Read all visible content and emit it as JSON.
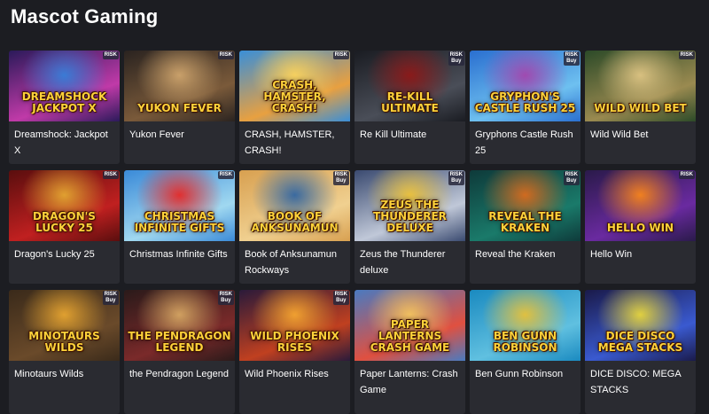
{
  "header": {
    "title": "Mascot Gaming"
  },
  "games": [
    {
      "title": "Dreamshock: Jackpot X",
      "logo": "Dreamshock Jackpot X",
      "badge": [
        "RISK"
      ],
      "colors": [
        "#2b1a5a",
        "#c03aa8",
        "#3a7bd5"
      ]
    },
    {
      "title": "Yukon Fever",
      "logo": "Yukon Fever",
      "badge": [
        "RISK"
      ],
      "colors": [
        "#2a2320",
        "#7a5a3a",
        "#c9a06a"
      ]
    },
    {
      "title": "CRASH, HAMSTER, CRASH!",
      "logo": "Crash, Hamster, Crash!",
      "badge": [
        "RISK"
      ],
      "colors": [
        "#3a8fd8",
        "#e8a040",
        "#f5d060"
      ]
    },
    {
      "title": "Re Kill Ultimate",
      "logo": "Re-Kill Ultimate",
      "badge": [
        "RISK",
        "Buy"
      ],
      "colors": [
        "#1a1c22",
        "#4a4e58",
        "#8a1a1a"
      ]
    },
    {
      "title": "Gryphons Castle Rush 25",
      "logo": "Gryphon's Castle Rush 25",
      "badge": [
        "RISK",
        "Buy"
      ],
      "colors": [
        "#2a6fd0",
        "#6ec0f0",
        "#a04ab0"
      ]
    },
    {
      "title": "Wild Wild Bet",
      "logo": "Wild Wild Bet",
      "badge": [
        "RISK"
      ],
      "colors": [
        "#2c4a28",
        "#9a8a50",
        "#d8c080"
      ]
    },
    {
      "title": "Dragon's Lucky 25",
      "logo": "Dragon's Lucky 25",
      "badge": [
        "RISK"
      ],
      "colors": [
        "#5a0e0e",
        "#c02020",
        "#e0a030"
      ]
    },
    {
      "title": "Christmas Infinite Gifts",
      "logo": "Christmas Infinite Gifts",
      "badge": [
        "RISK"
      ],
      "colors": [
        "#3a8ad8",
        "#a0d8f0",
        "#e03030"
      ]
    },
    {
      "title": "Book of Anksunamun Rockways",
      "logo": "Book of Anksunamun",
      "badge": [
        "RISK",
        "Buy"
      ],
      "colors": [
        "#d8a050",
        "#f0d090",
        "#3a6aa0"
      ]
    },
    {
      "title": "Zeus the Thunderer deluxe",
      "logo": "Zeus the Thunderer Deluxe",
      "badge": [
        "RISK",
        "Buy"
      ],
      "colors": [
        "#3a4a70",
        "#c0c8d8",
        "#e8c040"
      ]
    },
    {
      "title": "Reveal the Kraken",
      "logo": "Reveal the Kraken",
      "badge": [
        "RISK",
        "Buy"
      ],
      "colors": [
        "#0e3a3a",
        "#1a7a6a",
        "#d06a20"
      ]
    },
    {
      "title": "Hello Win",
      "logo": "Hello Win",
      "badge": [
        "RISK"
      ],
      "colors": [
        "#2a1a4a",
        "#6a2aa0",
        "#f08020"
      ]
    },
    {
      "title": "Minotaurs Wilds",
      "logo": "Minotaurs Wilds",
      "badge": [
        "RISK",
        "Buy"
      ],
      "colors": [
        "#3a2a1a",
        "#6a4a2a",
        "#e0a030"
      ]
    },
    {
      "title": "the Pendragon Legend",
      "logo": "The Pendragon Legend",
      "badge": [
        "RISK",
        "Buy"
      ],
      "colors": [
        "#2a1a1a",
        "#7a2a2a",
        "#d0a060"
      ]
    },
    {
      "title": "Wild Phoenix Rises",
      "logo": "Wild Phoenix Rises",
      "badge": [
        "RISK",
        "Buy"
      ],
      "colors": [
        "#2a1a3a",
        "#c04020",
        "#f0a030"
      ]
    },
    {
      "title": "Paper Lanterns: Crash Game",
      "logo": "Paper Lanterns Crash Game",
      "badge": [],
      "colors": [
        "#4a7ac0",
        "#e05040",
        "#f0c060"
      ]
    },
    {
      "title": "Ben Gunn Robinson",
      "logo": "Ben Gunn Robinson",
      "badge": [],
      "colors": [
        "#1a8ac0",
        "#60c0e0",
        "#e0c040"
      ]
    },
    {
      "title": "DICE DISCO: MEGA STACKS",
      "logo": "Dice Disco Mega Stacks",
      "badge": [],
      "colors": [
        "#1a1a4a",
        "#3a5ad0",
        "#e0d040"
      ]
    }
  ]
}
